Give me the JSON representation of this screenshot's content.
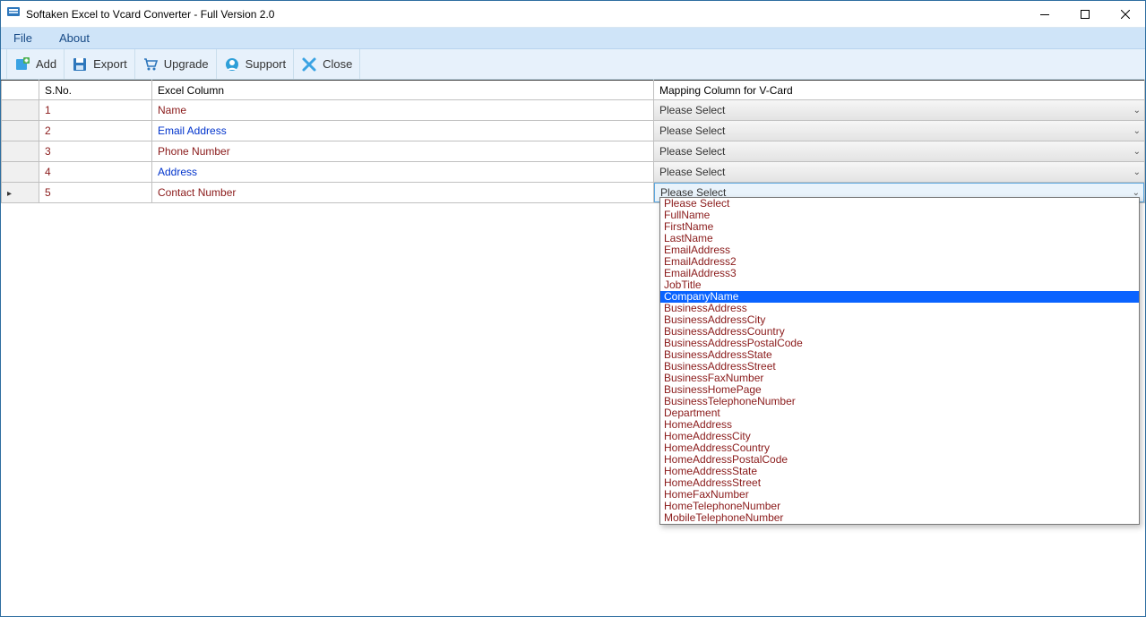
{
  "window": {
    "title": "Softaken Excel to Vcard Converter - Full Version 2.0"
  },
  "menubar": {
    "file": "File",
    "about": "About"
  },
  "toolbar": {
    "add": "Add",
    "export": "Export",
    "upgrade": "Upgrade",
    "support": "Support",
    "close": "Close"
  },
  "grid": {
    "headers": {
      "sno": "S.No.",
      "excel": "Excel Column",
      "map": "Mapping Column for V-Card"
    },
    "combo_placeholder": "Please Select",
    "rows": [
      {
        "sno": "1",
        "excel": "Name",
        "excel_color": "red"
      },
      {
        "sno": "2",
        "excel": "Email Address",
        "excel_color": "blue"
      },
      {
        "sno": "3",
        "excel": "Phone Number",
        "excel_color": "red"
      },
      {
        "sno": "4",
        "excel": "Address",
        "excel_color": "blue"
      },
      {
        "sno": "5",
        "excel": "Contact Number",
        "excel_color": "red"
      }
    ]
  },
  "dropdown": {
    "selected_index": 8,
    "options": [
      "Please Select",
      "FullName",
      "FirstName",
      "LastName",
      "EmailAddress",
      "EmailAddress2",
      "EmailAddress3",
      "JobTitle",
      "CompanyName",
      "BusinessAddress",
      "BusinessAddressCity",
      "BusinessAddressCountry",
      "BusinessAddressPostalCode",
      "BusinessAddressState",
      "BusinessAddressStreet",
      "BusinessFaxNumber",
      "BusinessHomePage",
      "BusinessTelephoneNumber",
      "Department",
      "HomeAddress",
      "HomeAddressCity",
      "HomeAddressCountry",
      "HomeAddressPostalCode",
      "HomeAddressState",
      "HomeAddressStreet",
      "HomeFaxNumber",
      "HomeTelephoneNumber",
      "MobileTelephoneNumber"
    ]
  }
}
